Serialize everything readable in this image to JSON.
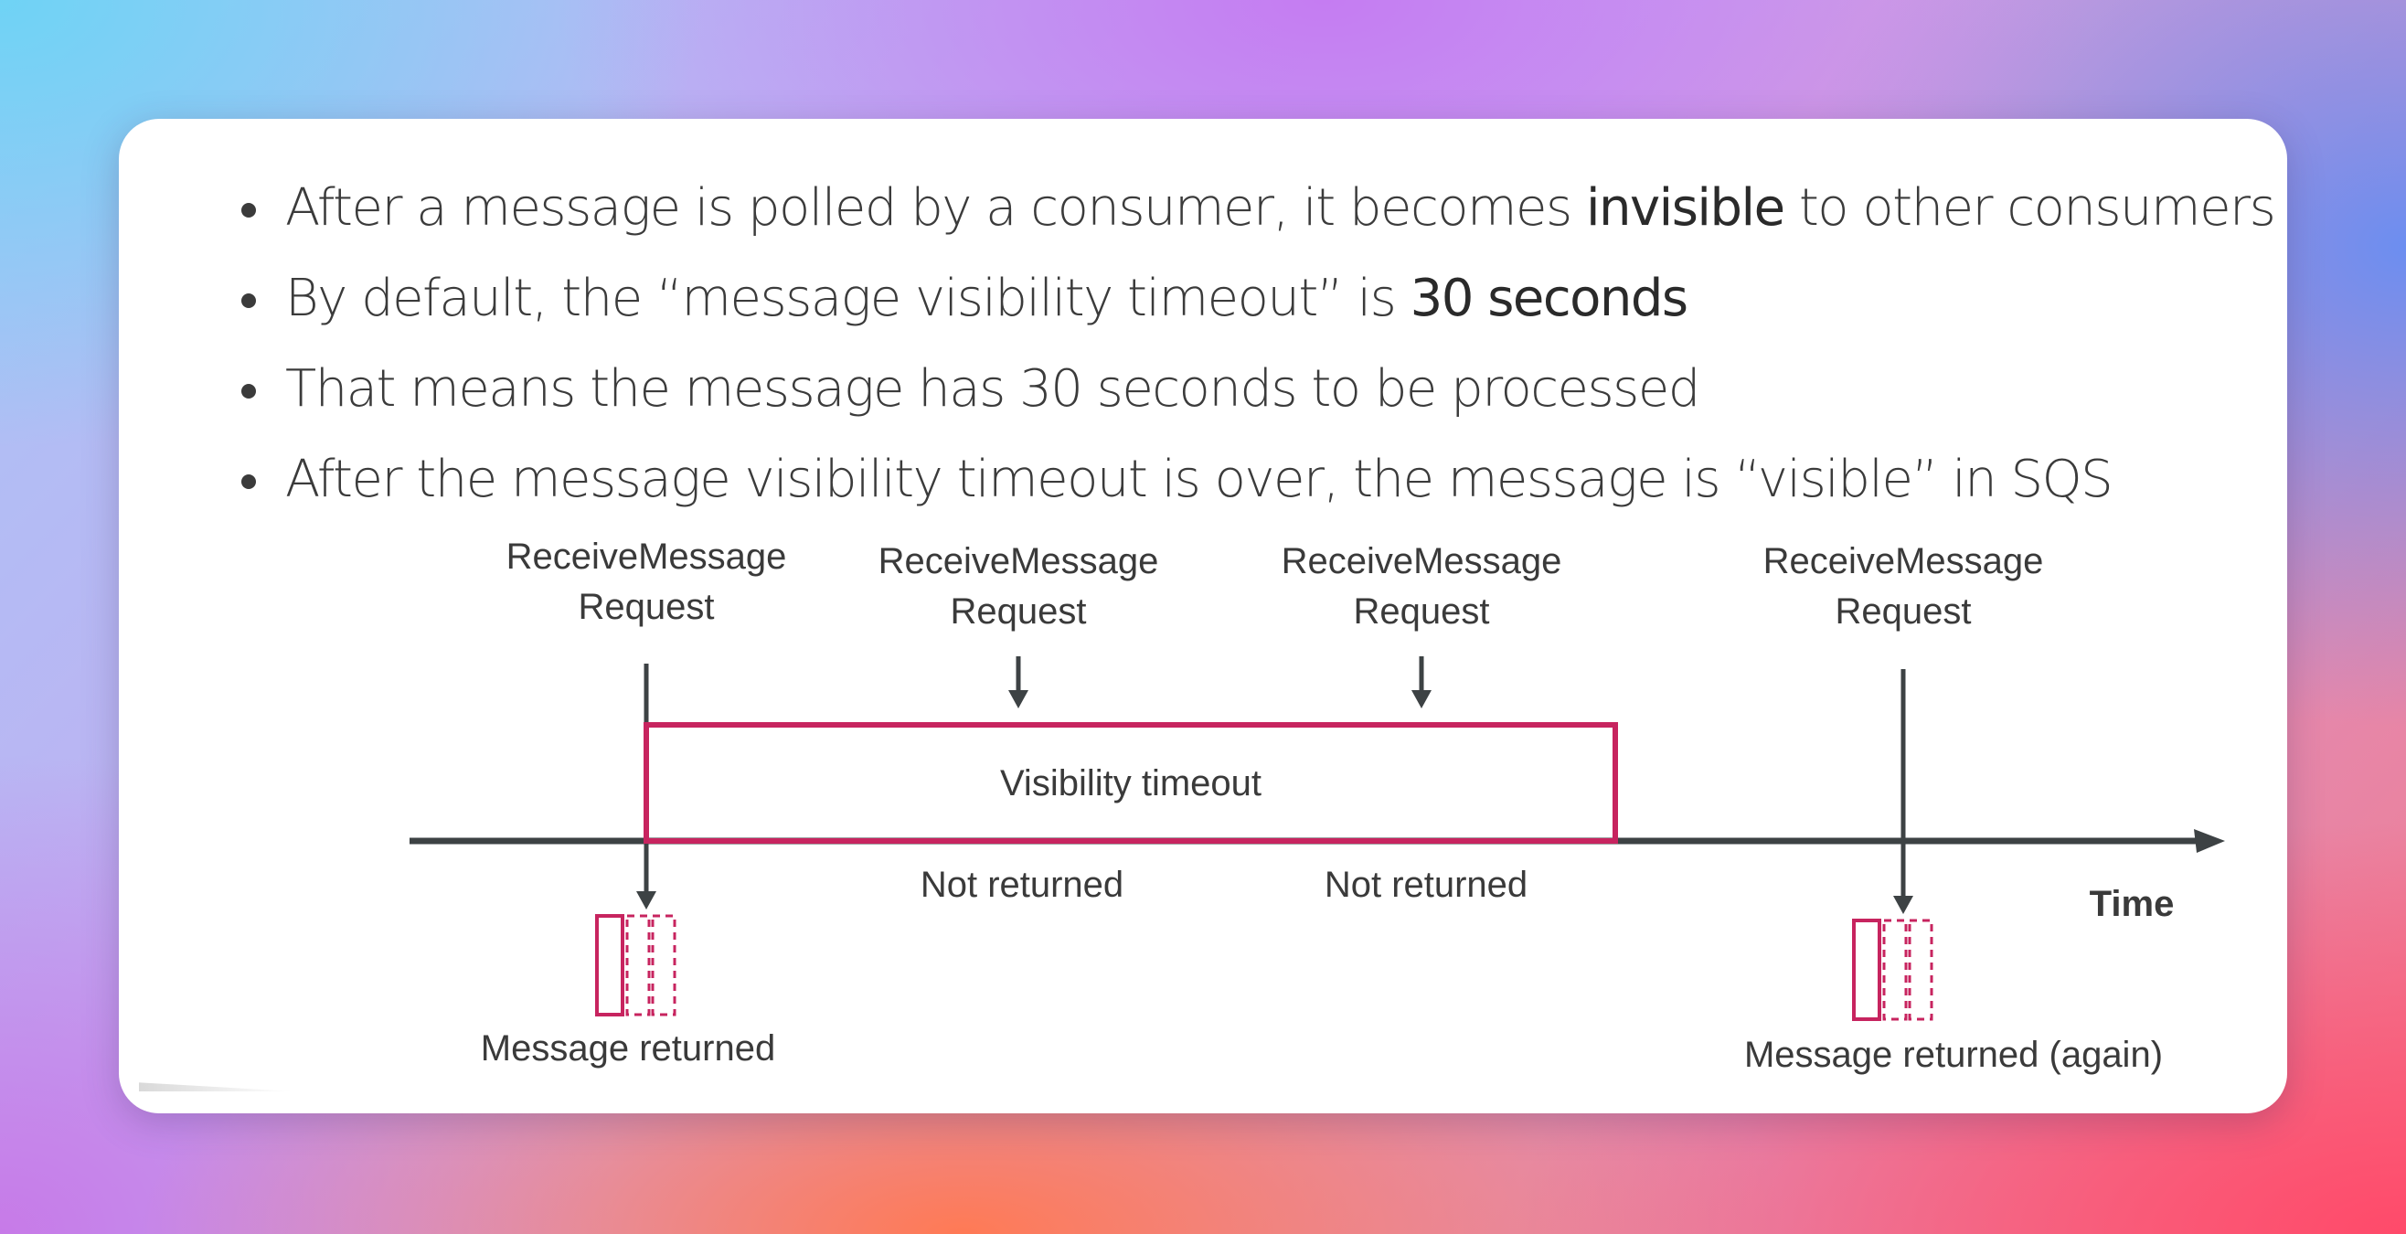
{
  "bullets": [
    {
      "parts": [
        "After a message is polled by a consumer, it becomes ",
        "invisible",
        " to other consumers"
      ]
    },
    {
      "parts": [
        "By default, the “message visibility timeout” is ",
        "30 seconds",
        ""
      ]
    },
    {
      "parts": [
        "That means the message has 30 seconds to be processed",
        "",
        ""
      ]
    },
    {
      "parts": [
        "After the message visibility timeout is over, the message is “visible” in SQS",
        "",
        ""
      ]
    }
  ],
  "diagram": {
    "requests": [
      {
        "line1": "ReceiveMessage",
        "line2": "Request"
      },
      {
        "line1": "ReceiveMessage",
        "line2": "Request"
      },
      {
        "line1": "ReceiveMessage",
        "line2": "Request"
      },
      {
        "line1": "ReceiveMessage",
        "line2": "Request"
      }
    ],
    "timeout_label": "Visibility timeout",
    "not_returned": [
      "Not returned",
      "Not returned"
    ],
    "axis_label": "Time",
    "message_returned": "Message returned",
    "message_returned_again": "Message returned (again)"
  },
  "colors": {
    "accent": "#c7245f",
    "axis": "#3d4244",
    "text": "#3a3a3a"
  }
}
